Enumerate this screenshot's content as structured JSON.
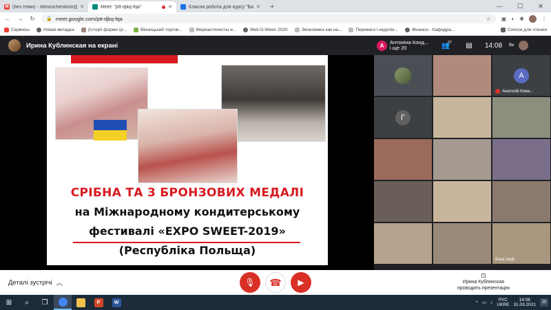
{
  "browser": {
    "tabs": [
      {
        "title": "(без теми) - ntimoschenkom@g",
        "favicon_color": "#ea4335",
        "favicon_glyph": "M",
        "active": false
      },
      {
        "title": "Meet: \"ptt-djkq-fqa\"",
        "favicon_color": "#00897b",
        "favicon_glyph": "",
        "active": true,
        "recording": true
      },
      {
        "title": "Класна робота для курсу \"Бани",
        "favicon_color": "#1a73e8",
        "favicon_glyph": "",
        "active": false
      }
    ],
    "new_tab": "+",
    "url": "meet.google.com/ptt-djkq-fqa",
    "bookmarks": [
      {
        "label": "Сервисы",
        "color": "#e94235"
      },
      {
        "label": "Новая вкладка",
        "color": "#5f6368"
      },
      {
        "label": "(Історії форми гр...",
        "color": "#a1887f"
      },
      {
        "label": "Вінницький торгов...",
        "color": "#7cb342"
      },
      {
        "label": "Меркантилисты и...",
        "color": "#bdbdbd"
      },
      {
        "label": "Mell-O-Ween 2020",
        "color": "#5f6368"
      },
      {
        "label": "Экономика как на...",
        "color": "#bdbdbd"
      },
      {
        "label": "Переваги і недолік...",
        "color": "#bdbdbd"
      },
      {
        "label": "Фінанси - Кафедра...",
        "color": "#5f6368"
      }
    ],
    "reading_list": "Список для чтения"
  },
  "meet": {
    "presenter_label": "Ирина Кублинская на екрані",
    "panel": {
      "badge_letter": "A",
      "names_line1": "Антоніна Конд...",
      "names_line2": "і ще 20",
      "people_count": "37",
      "time": "14:08",
      "you": "Ви"
    },
    "slide": {
      "line1": "СРІБНА ТА 3 БРОНЗОВИХ МЕДАЛІ",
      "line2": "на Міжнародному кондитерському",
      "line3": "фестивалі «EXPO SWEET-2019»",
      "line4": "(Республіка Польща)"
    },
    "tiles": [
      {
        "type": "video",
        "bg": "#4a4f55",
        "small_avatar": true
      },
      {
        "type": "video",
        "bg": "#b08a7a"
      },
      {
        "type": "letter",
        "letter": "A",
        "letter_bg": "#5c6bc0",
        "bg": "#3c4043",
        "name": "Анатолій Кожа...",
        "muted": true
      },
      {
        "type": "letter",
        "letter": "Г",
        "letter_bg": "#616161",
        "bg": "#3c4043"
      },
      {
        "type": "video",
        "bg": "#c7b69b"
      },
      {
        "type": "video",
        "bg": "#8a8f7e"
      },
      {
        "type": "video",
        "bg": "#9a6a5a"
      },
      {
        "type": "video",
        "bg": "#a49a90"
      },
      {
        "type": "video",
        "bg": "#7a6e8a"
      },
      {
        "type": "video",
        "bg": "#6a5f58"
      },
      {
        "type": "video",
        "bg": "#c9b59c"
      },
      {
        "type": "video",
        "bg": "#8a7a6e"
      },
      {
        "type": "video",
        "bg": "#b6a38e"
      },
      {
        "type": "video",
        "bg": "#9a8a7a"
      },
      {
        "type": "video",
        "bg": "#a8967e",
        "name": "Ваші опції"
      }
    ],
    "controls": {
      "details_label": "Деталі зустрічі",
      "presenting_line1": "Ирина Кублинская",
      "presenting_line2": "проводить презентацію"
    }
  },
  "taskbar": {
    "apps": [
      {
        "name": "chrome",
        "color": "#4285f4",
        "glyph": "",
        "active": true
      },
      {
        "name": "explorer",
        "color": "#f2c14e",
        "glyph": "",
        "active": false
      },
      {
        "name": "powerpoint",
        "color": "#d24726",
        "glyph": "P",
        "active": false
      },
      {
        "name": "word",
        "color": "#2b579a",
        "glyph": "W",
        "active": false
      }
    ],
    "lang_line1": "РУС",
    "lang_line2": "UKRE",
    "time": "14:08",
    "date": "31.03.2021",
    "notif_count": "20"
  }
}
